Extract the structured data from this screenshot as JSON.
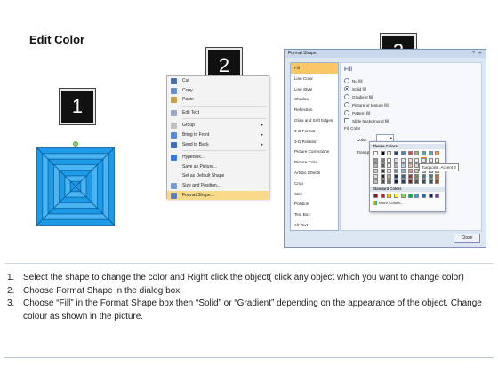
{
  "title": "Edit Color",
  "step_badges": [
    "1",
    "2",
    "3"
  ],
  "context_menu": [
    {
      "label": "Cut",
      "icon": "scissors-icon",
      "color": "#4a6fa5",
      "arrow": ""
    },
    {
      "label": "Copy",
      "icon": "copy-icon",
      "color": "#6b8fc7",
      "arrow": ""
    },
    {
      "label": "Paste",
      "icon": "paste-icon",
      "color": "#c9a24a",
      "arrow": ""
    },
    {
      "label": "Edit Text",
      "icon": "edit-text-icon",
      "color": "#9aa9bf",
      "arrow": "",
      "sep_before": true
    },
    {
      "label": "Group",
      "icon": "group-icon",
      "color": "#c0c0c0",
      "arrow": "▸",
      "sep_before": true
    },
    {
      "label": "Bring to Front",
      "icon": "bring-front-icon",
      "color": "#5a8bd6",
      "arrow": "▸"
    },
    {
      "label": "Send to Back",
      "icon": "send-back-icon",
      "color": "#3f6db8",
      "arrow": "▸"
    },
    {
      "label": "Hyperlink...",
      "icon": "hyperlink-icon",
      "color": "#3a7bd5",
      "arrow": "",
      "sep_before": true
    },
    {
      "label": "Save as Picture...",
      "icon": "",
      "color": "",
      "arrow": ""
    },
    {
      "label": "Set as Default Shape",
      "icon": "",
      "color": "",
      "arrow": ""
    },
    {
      "label": "Size and Position...",
      "icon": "size-position-icon",
      "color": "#7c9ccf",
      "arrow": ""
    },
    {
      "label": "Format Shape...",
      "icon": "format-shape-icon",
      "color": "#5b7fb8",
      "arrow": "",
      "highlight": true
    }
  ],
  "dialog": {
    "title": "Format Shape",
    "controls": [
      "?",
      "✕"
    ],
    "left_items": [
      "Fill",
      "Line Color",
      "Line Style",
      "Shadow",
      "Reflection",
      "Glow and Soft Edges",
      "3-D Format",
      "3-D Rotation",
      "Picture Corrections",
      "Picture Color",
      "Artistic Effects",
      "Crop",
      "Size",
      "Position",
      "Text Box",
      "Alt Text"
    ],
    "selected_left": "Fill",
    "fill_heading": "Fill",
    "options": [
      {
        "label": "No fill",
        "type": "radio",
        "on": false
      },
      {
        "label": "Solid fill",
        "type": "radio",
        "on": true
      },
      {
        "label": "Gradient fill",
        "type": "radio",
        "on": false
      },
      {
        "label": "Picture or texture fill",
        "type": "radio",
        "on": false
      },
      {
        "label": "Pattern fill",
        "type": "radio",
        "on": false
      },
      {
        "label": "Slide background fill",
        "type": "radio",
        "on": false
      }
    ],
    "fill_color_label": "Fill Color",
    "color_label": "Color:",
    "transparency_label": "Transpa",
    "close_label": "Close"
  },
  "color_palette": {
    "theme_heading": "Theme Colors",
    "standard_heading": "Standard Colors",
    "more_colors": "More Colors...",
    "tooltip": "Turquoise, Accent 3",
    "theme_top": [
      "#ffffff",
      "#000000",
      "#eeece1",
      "#1f497d",
      "#4f81bd",
      "#c0504d",
      "#9bbb59",
      "#31b6c4",
      "#4bacc6",
      "#f79646"
    ],
    "standard": [
      "#c00000",
      "#ff0000",
      "#ffc000",
      "#ffff00",
      "#92d050",
      "#00b050",
      "#00b0f0",
      "#0070c0",
      "#002060",
      "#7030a0"
    ]
  },
  "instructions": [
    {
      "n": "1.",
      "text": "Select the shape to change the color and Right click the object( click any object which you want to change color)"
    },
    {
      "n": "2.",
      "text": "Choose Format Shape in the dialog box."
    },
    {
      "n": "3.",
      "text": "Choose “Fill” in the Format Shape box then “Solid” or “Gradient” depending on the appearance of the object. Change colour as shown in the picture."
    }
  ]
}
